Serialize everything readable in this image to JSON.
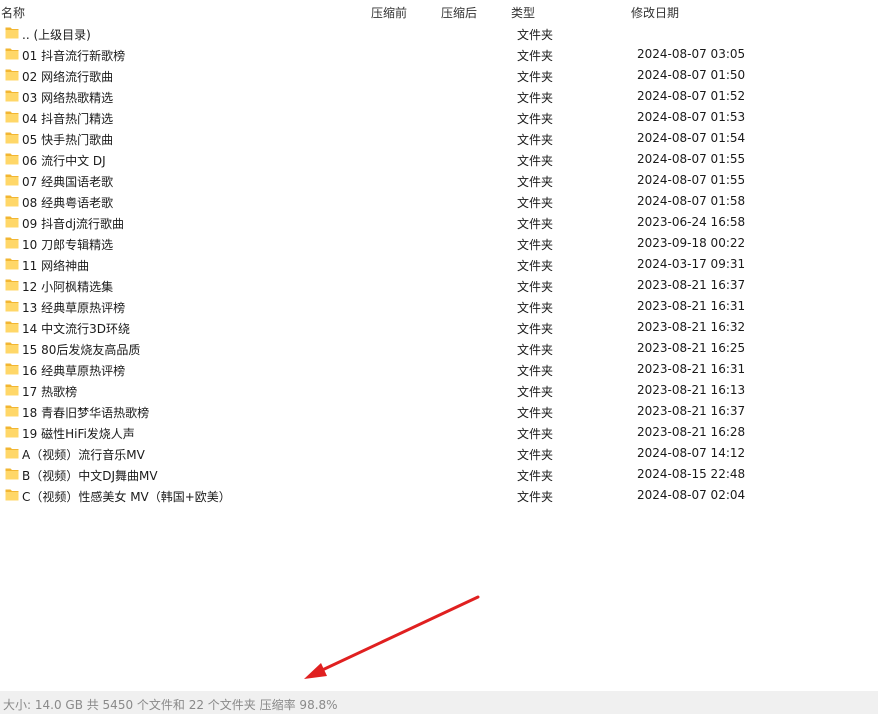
{
  "columns": {
    "name": "名称",
    "before": "压缩前",
    "after": "压缩后",
    "type": "类型",
    "date": "修改日期"
  },
  "rows": [
    {
      "name": ".. (上级目录)",
      "type": "文件夹",
      "date": "",
      "icon": "folder-icon"
    },
    {
      "name": "01 抖音流行新歌榜",
      "type": "文件夹",
      "date": "2024-08-07 03:05",
      "icon": "folder-icon"
    },
    {
      "name": "02 网络流行歌曲",
      "type": "文件夹",
      "date": "2024-08-07 01:50",
      "icon": "folder-icon"
    },
    {
      "name": "03 网络热歌精选",
      "type": "文件夹",
      "date": "2024-08-07 01:52",
      "icon": "folder-icon"
    },
    {
      "name": "04 抖音热门精选",
      "type": "文件夹",
      "date": "2024-08-07 01:53",
      "icon": "folder-icon"
    },
    {
      "name": "05 快手热门歌曲",
      "type": "文件夹",
      "date": "2024-08-07 01:54",
      "icon": "folder-icon"
    },
    {
      "name": "06 流行中文 DJ",
      "type": "文件夹",
      "date": "2024-08-07 01:55",
      "icon": "folder-icon"
    },
    {
      "name": "07 经典国语老歌",
      "type": "文件夹",
      "date": "2024-08-07 01:55",
      "icon": "folder-icon"
    },
    {
      "name": "08 经典粤语老歌",
      "type": "文件夹",
      "date": "2024-08-07 01:58",
      "icon": "folder-icon"
    },
    {
      "name": "09 抖音dj流行歌曲",
      "type": "文件夹",
      "date": "2023-06-24 16:58",
      "icon": "folder-icon"
    },
    {
      "name": "10 刀郎专辑精选",
      "type": "文件夹",
      "date": "2023-09-18 00:22",
      "icon": "folder-icon"
    },
    {
      "name": "11 网络神曲",
      "type": "文件夹",
      "date": "2024-03-17 09:31",
      "icon": "folder-icon"
    },
    {
      "name": "12 小阿枫精选集",
      "type": "文件夹",
      "date": "2023-08-21 16:37",
      "icon": "folder-icon"
    },
    {
      "name": "13 经典草原热评榜",
      "type": "文件夹",
      "date": "2023-08-21 16:31",
      "icon": "folder-icon"
    },
    {
      "name": "14 中文流行3D环绕",
      "type": "文件夹",
      "date": "2023-08-21 16:32",
      "icon": "folder-icon"
    },
    {
      "name": "15 80后发烧友高品质",
      "type": "文件夹",
      "date": "2023-08-21 16:25",
      "icon": "folder-icon"
    },
    {
      "name": "16 经典草原热评榜",
      "type": "文件夹",
      "date": "2023-08-21 16:31",
      "icon": "folder-icon"
    },
    {
      "name": "17 热歌榜",
      "type": "文件夹",
      "date": "2023-08-21 16:13",
      "icon": "folder-icon"
    },
    {
      "name": "18 青春旧梦华语热歌榜",
      "type": "文件夹",
      "date": "2023-08-21 16:37",
      "icon": "folder-icon"
    },
    {
      "name": "19 磁性HiFi发烧人声",
      "type": "文件夹",
      "date": "2023-08-21 16:28",
      "icon": "folder-icon"
    },
    {
      "name": "A（视频）流行音乐MV",
      "type": "文件夹",
      "date": "2024-08-07 14:12",
      "icon": "folder-icon"
    },
    {
      "name": "B（视频）中文DJ舞曲MV",
      "type": "文件夹",
      "date": "2024-08-15 22:48",
      "icon": "folder-icon"
    },
    {
      "name": "C（视频）性感美女 MV（韩国+欧美）",
      "type": "文件夹",
      "date": "2024-08-07 02:04",
      "icon": "folder-icon"
    }
  ],
  "status": {
    "text": "大小: 14.0 GB 共 5450 个文件和 22 个文件夹 压缩率 98.8%"
  },
  "annotation": {
    "icon": "red-arrow-icon",
    "color": "#e02020"
  },
  "colors": {
    "folder_front": "#ffd768",
    "folder_back": "#f2b632",
    "status_bg": "#f0f0f0",
    "status_text": "#8a8a8a"
  }
}
